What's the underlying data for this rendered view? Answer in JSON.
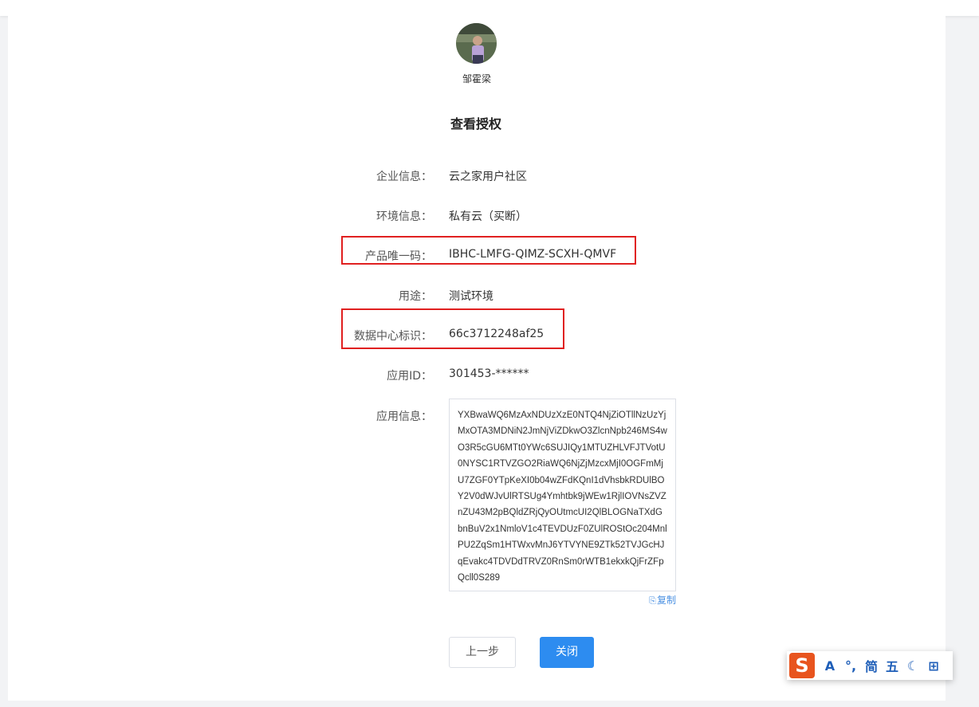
{
  "user": {
    "name": "邹霍梁"
  },
  "page": {
    "title": "查看授权"
  },
  "fields": {
    "company": {
      "label": "企业信息：",
      "value": "云之家用户社区"
    },
    "environment": {
      "label": "环境信息：",
      "value": "私有云（买断）"
    },
    "product_code": {
      "label": "产品唯一码：",
      "value": "IBHC-LMFG-QIMZ-SCXH-QMVF"
    },
    "usage": {
      "label": "用途：",
      "value": "测试环境"
    },
    "datacenter_id": {
      "label": "数据中心标识：",
      "value": "66c3712248af25"
    },
    "app_id": {
      "label": "应用ID：",
      "value": "301453-******"
    },
    "app_info": {
      "label": "应用信息：",
      "value": "YXBwaWQ6MzAxNDUzXzE0NTQ4NjZiOTllNzUzYjMxOTA3MDNiN2JmNjViZDkwO3ZlcnNpb246MS4wO3R5cGU6MTt0YWc6SUJIQy1MTUZHLVFJTVotU0NYSC1RTVZGO2RiaWQ6NjZjMzcxMjI0OGFmMjU7ZGF0YTpKeXI0b04wZFdKQnI1dVhsbkRDUlBOY2V0dWJvUlRTSUg4Ymhtbk9jWEw1RjlIOVNsZVZnZU43M2pBQldZRjQyOUtmcUI2QlBLOGNaTXdGbnBuV2x1NmloV1c4TEVDUzF0ZUlROStOc204MnlPU2ZqSm1HTWxvMnJ6YTVYNE9ZTk52TVJGcHJqEvakc4TDVDdTRVZ0RnSm0rWTB1ekxkQjFrZFpQcll0S289",
      "copy_label": "复制"
    }
  },
  "actions": {
    "prev_label": "上一步",
    "close_label": "关闭"
  },
  "ime_toolbar": {
    "logo": "S",
    "items": [
      "A",
      "°,",
      "简",
      "五",
      "☾",
      "⊞"
    ]
  },
  "colors": {
    "primary": "#2d8cf0",
    "highlight": "#e02020",
    "link": "#4a90e2",
    "ime_brand": "#e8541e"
  }
}
